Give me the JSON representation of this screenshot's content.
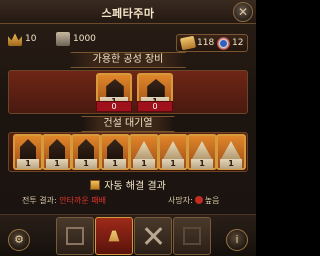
{
  "window": {
    "title": "스페타주마",
    "close_label": "✕"
  },
  "resources": {
    "crowns": "10",
    "scrolls": "1000",
    "tickets": "118",
    "medals": "12"
  },
  "siege_section": {
    "title": "가용한 공성 장비"
  },
  "siege_items": [
    {
      "badge": "1",
      "stock": "0",
      "art": "catapult"
    },
    {
      "badge": "1",
      "stock": "0",
      "art": "catapult"
    }
  ],
  "queue_section": {
    "title": "건설 대기열"
  },
  "queue_items": [
    {
      "badge": "1",
      "art": "catapult"
    },
    {
      "badge": "1",
      "art": "catapult"
    },
    {
      "badge": "1",
      "art": "catapult"
    },
    {
      "badge": "1",
      "art": "catapult"
    },
    {
      "badge": "1",
      "art": "tent"
    },
    {
      "badge": "1",
      "art": "tent"
    },
    {
      "badge": "1",
      "art": "tent"
    },
    {
      "badge": "1",
      "art": "tent"
    }
  ],
  "auto_resolve": {
    "label": "자동 해결 결과"
  },
  "battle_result": {
    "label": "전투 결과:",
    "value": "안타까운 패배"
  },
  "casualties": {
    "label": "사망자:",
    "value": "높음"
  },
  "icons": {
    "close": "close-icon",
    "crown": "crown-icon",
    "scroll": "scroll-icon",
    "ticket": "ticket-icon",
    "medal": "medal-icon",
    "gear": "gear-icon",
    "info": "info-icon",
    "swords": "crossed-swords-icon"
  },
  "colors": {
    "accent": "#d49a3c",
    "defeat": "#e0332a",
    "stock": "#a0121b"
  }
}
